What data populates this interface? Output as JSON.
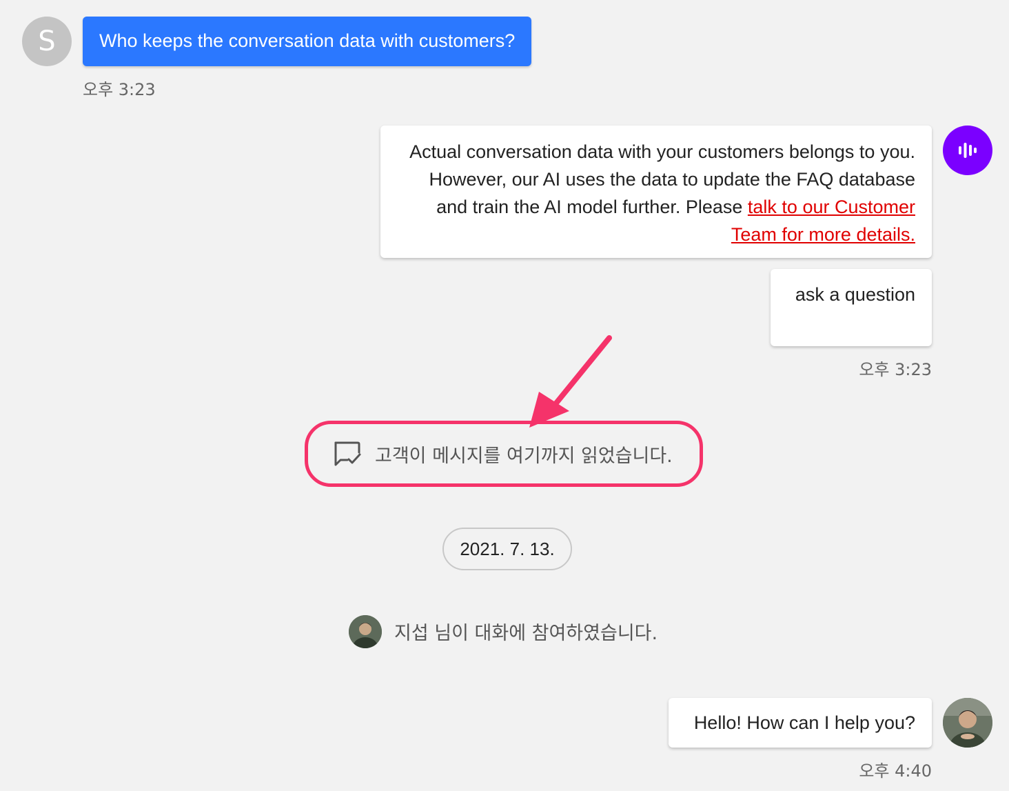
{
  "customer": {
    "avatar_initial": "S",
    "message": "Who keeps the conversation data with customers?",
    "time": "오후 3:23"
  },
  "bot": {
    "message_text": "Actual conversation data with your customers belongs to you. However, our AI uses the data to update the FAQ database and train the AI model further. Please ",
    "message_link": "talk to our Customer Team for more details.",
    "button_message": "ask a question",
    "time": "오후 3:23",
    "avatar_icon": "voice-bars-icon"
  },
  "read_receipt": {
    "icon": "message-check-icon",
    "text": "고객이 메시지를 여기까지 읽었습니다."
  },
  "date_separator": "2021. 7. 13.",
  "agent_join": {
    "text": "지섭 님이 대화에 참여하였습니다."
  },
  "agent": {
    "message": "Hello! How can I help you?",
    "time": "오후 4:40"
  },
  "colors": {
    "background": "#f2f2f2",
    "customer_bubble": "#2b78ff",
    "bot_avatar": "#7b00ff",
    "link": "#e00000",
    "highlight": "#f5336a"
  }
}
